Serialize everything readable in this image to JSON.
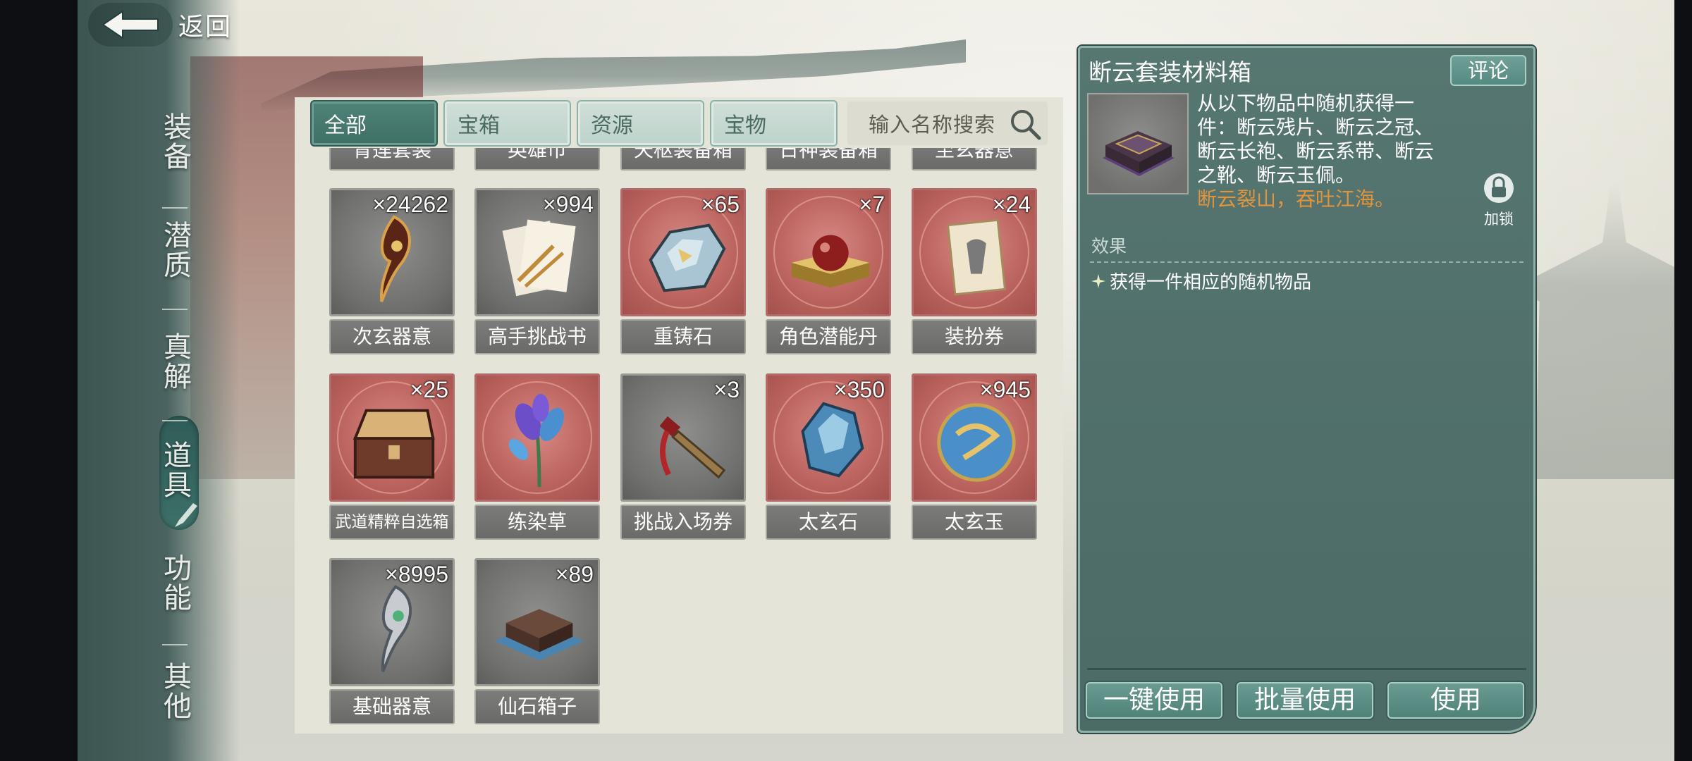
{
  "header": {
    "back_label": "返回"
  },
  "side_nav": [
    {
      "label": [
        "装",
        "备"
      ]
    },
    {
      "label": [
        "潜",
        "质"
      ]
    },
    {
      "label": [
        "真",
        "解"
      ]
    },
    {
      "label": [
        "道",
        "具"
      ],
      "active": true
    },
    {
      "label": [
        "功",
        "能"
      ]
    },
    {
      "label": [
        "其",
        "他"
      ]
    }
  ],
  "tabs": [
    {
      "label": "全部",
      "active": true
    },
    {
      "label": "宝箱"
    },
    {
      "label": "资源"
    },
    {
      "label": "宝物"
    }
  ],
  "search": {
    "placeholder": "输入名称搜索"
  },
  "top_row_partial": [
    "青莲套装",
    "英雄币",
    "天枢装备箱",
    "日神装备箱",
    "至玄器意"
  ],
  "items": [
    {
      "name": "次玄器意",
      "count": "×24262",
      "rarity": "gray",
      "icon": "weapon-spirit-icon"
    },
    {
      "name": "高手挑战书",
      "count": "×994",
      "rarity": "gray",
      "icon": "challenge-letter-icon"
    },
    {
      "name": "重铸石",
      "count": "×65",
      "rarity": "red",
      "icon": "reforge-stone-icon"
    },
    {
      "name": "角色潜能丹",
      "count": "×7",
      "rarity": "red",
      "icon": "potential-pill-icon"
    },
    {
      "name": "装扮券",
      "count": "×24",
      "rarity": "red",
      "icon": "costume-ticket-icon"
    },
    {
      "name": "武道精粹自选箱",
      "count": "×25",
      "rarity": "red",
      "icon": "treasure-chest-icon"
    },
    {
      "name": "练染草",
      "count": "",
      "rarity": "red",
      "icon": "herb-icon"
    },
    {
      "name": "挑战入场券",
      "count": "×3",
      "rarity": "gray",
      "icon": "dagger-ticket-icon"
    },
    {
      "name": "太玄石",
      "count": "×350",
      "rarity": "red",
      "icon": "blue-crystal-icon"
    },
    {
      "name": "太玄玉",
      "count": "×945",
      "rarity": "red",
      "icon": "jade-orb-icon"
    },
    {
      "name": "基础器意",
      "count": "×8995",
      "rarity": "gray",
      "icon": "basic-spirit-icon"
    },
    {
      "name": "仙石箱子",
      "count": "×89",
      "rarity": "gray",
      "icon": "stone-box-icon"
    }
  ],
  "detail": {
    "title": "断云套装材料箱",
    "comment_label": "评论",
    "description": "从以下物品中随机获得一件：断云残片、断云之冠、断云长袍、断云系带、断云之靴、断云玉佩。",
    "flavor": "断云裂山，吞吐江海。",
    "lock_label": "加锁",
    "effect_heading": "效果",
    "effect_text": "获得一件相应的随机物品",
    "buttons": {
      "use_all": "一键使用",
      "batch_use": "批量使用",
      "use": "使用"
    }
  },
  "colors": {
    "accent_teal": "#4f8379",
    "rarity_red": "#bd6560",
    "rarity_gray": "#6f6f6e",
    "flavor_orange": "#e2943c"
  }
}
